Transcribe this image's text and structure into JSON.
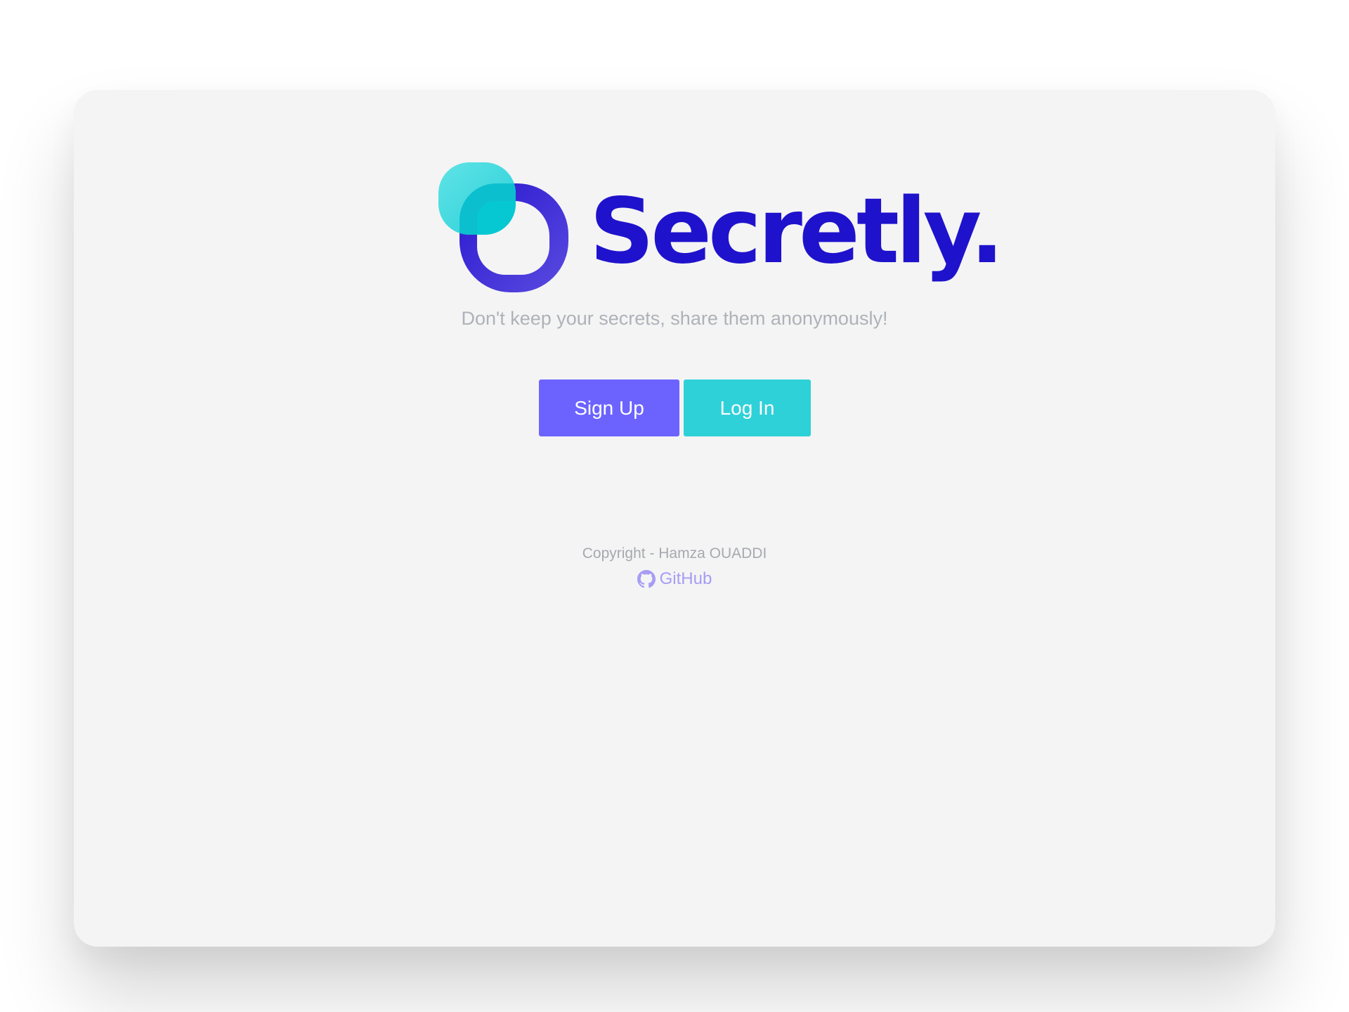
{
  "brand": {
    "name": "Secretly.",
    "tagline": "Don't keep your secrets, share them anonymously!",
    "logo_icon": "overlapping-squircles-logo",
    "colors": {
      "primary": "#1f12cc",
      "teal": "#2fd1d8"
    }
  },
  "actions": {
    "signup_label": "Sign Up",
    "login_label": "Log In",
    "signup_color": "#6c63ff",
    "login_color": "#2fd1d8"
  },
  "footer": {
    "copyright": "Copyright - Hamza OUADDI",
    "github_label": "GitHub",
    "github_icon": "github-icon"
  }
}
